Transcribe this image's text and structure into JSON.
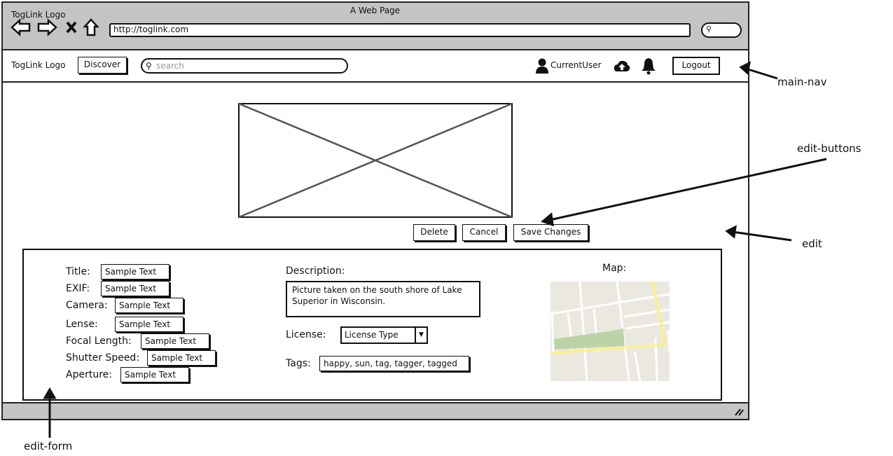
{
  "browser": {
    "title": "A Web Page",
    "logo": "TogLink Logo",
    "url": "http://toglink.com"
  },
  "nav": {
    "logo": "TogLink Logo",
    "discover": "Discover",
    "search_placeholder": "search",
    "user": "CurrentUser",
    "logout": "Logout"
  },
  "edit_buttons": {
    "delete": "Delete",
    "cancel": "Cancel",
    "save": "Save Changes"
  },
  "form": {
    "fields": [
      {
        "label": "Title:",
        "value": "Sample Text"
      },
      {
        "label": "EXIF:",
        "value": "Sample Text"
      },
      {
        "label": "Camera:",
        "value": "Sample Text"
      },
      {
        "label": "Lense:",
        "value": "Sample Text"
      },
      {
        "label": "Focal Length:",
        "value": "Sample Text"
      },
      {
        "label": "Shutter Speed:",
        "value": "Sample Text"
      },
      {
        "label": "Aperture:",
        "value": "Sample Text"
      }
    ],
    "description_label": "Description:",
    "description": "Picture taken on the south shore of Lake Superior in Wisconsin.",
    "license_label": "License:",
    "license": "License Type",
    "tags_label": "Tags:",
    "tags": "happy, sun, tag, tagger, tagged",
    "map_label": "Map:"
  },
  "annotations": {
    "main_nav": "main-nav",
    "edit_buttons": "edit-buttons",
    "edit": "edit",
    "edit_form": "edit-form"
  }
}
